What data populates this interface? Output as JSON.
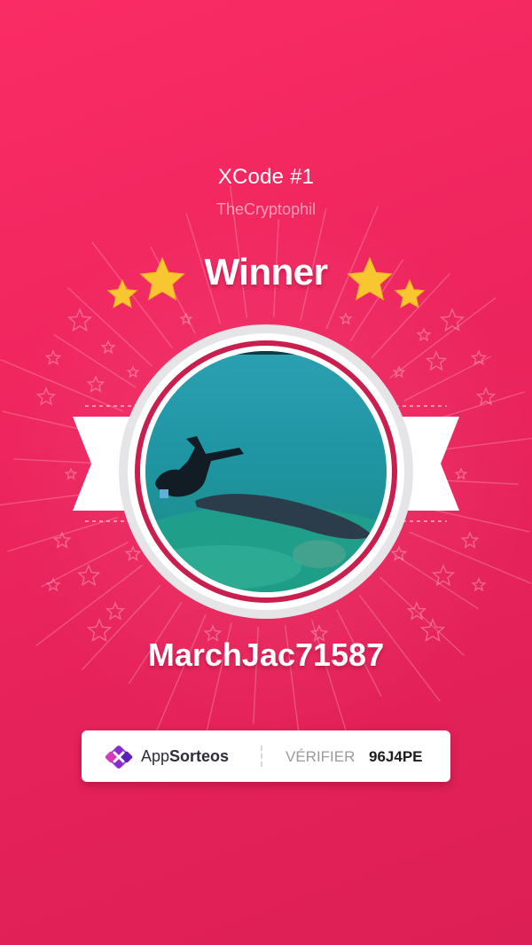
{
  "page": {
    "title": "XCode #1",
    "subtitle": "TheCryptophil",
    "badge_label": "Winner",
    "winner_name": "MarchJac71587",
    "background_color": "#ef265e",
    "accent_star_color": "#f7c631"
  },
  "verification": {
    "brand_prefix": "App",
    "brand_suffix": "Sorteos",
    "label": "VÉRIFIER",
    "code": "96J4PE"
  },
  "icons": {
    "stars": "star-icon",
    "brand": "appsorteos-logo-icon"
  }
}
